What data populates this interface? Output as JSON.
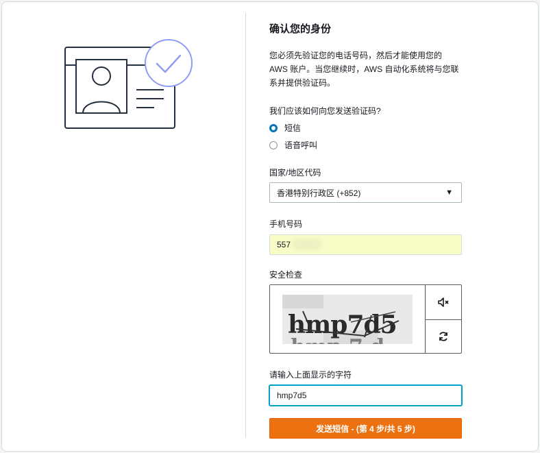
{
  "heading": "确认您的身份",
  "description": "您必须先验证您的电话号码，然后才能使用您的 AWS 账户。当您继续时，AWS 自动化系统将与您联系并提供验证码。",
  "contact_method": {
    "question": "我们应该如何向您发送验证码?",
    "options": [
      {
        "label": "短信",
        "checked": true
      },
      {
        "label": "语音呼叫",
        "checked": false
      }
    ]
  },
  "country": {
    "label": "国家/地区代码",
    "selected": "香港特别行政区 (+852)"
  },
  "phone": {
    "label": "手机号码",
    "value": "557"
  },
  "security_check": {
    "label": "安全检查",
    "captcha_text": "hmp7d5",
    "audio_icon": "speaker-icon",
    "refresh_icon": "refresh-icon"
  },
  "captcha_input": {
    "label": "请输入上面显示的字符",
    "value": "hmp7d5"
  },
  "submit_label": "发送短信 - (第 4 步/共 5 步)",
  "colors": {
    "accent": "#0073bb",
    "primary_button": "#ec7211",
    "illustration_check": "#8f9cf5",
    "autofill": "#fafcc8"
  }
}
